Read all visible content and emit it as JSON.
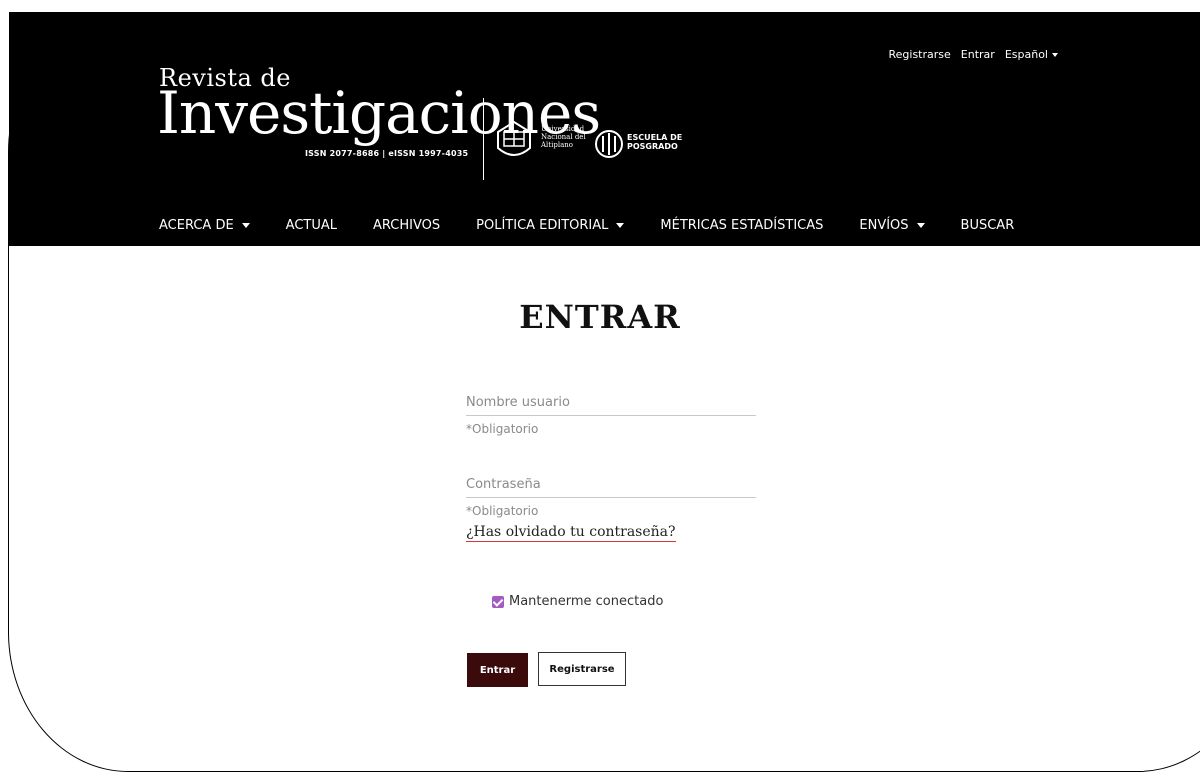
{
  "header": {
    "logo": {
      "line1": "Revista de",
      "line2": "Investigaciones",
      "issn": "ISSN 2077-8686 | eISSN 1997-4035",
      "university": "Universidad\nNacional del\nAltiplano",
      "school": "ESCUELA DE\nPOSGRADO"
    },
    "topnav": {
      "register": "Registrarse",
      "login": "Entrar",
      "language": "Español"
    },
    "mainnav": [
      {
        "label": "ACERCA DE",
        "dropdown": true
      },
      {
        "label": "ACTUAL",
        "dropdown": false
      },
      {
        "label": "ARCHIVOS",
        "dropdown": false
      },
      {
        "label": "POLÍTICA EDITORIAL",
        "dropdown": true
      },
      {
        "label": "MÉTRICAS ESTADÍSTICAS",
        "dropdown": false
      },
      {
        "label": "ENVÍOS",
        "dropdown": true
      },
      {
        "label": "BUSCAR",
        "dropdown": false
      }
    ]
  },
  "login": {
    "title": "ENTRAR",
    "username": {
      "placeholder": "Nombre usuario",
      "required": "*Obligatorio"
    },
    "password": {
      "placeholder": "Contraseña",
      "required": "*Obligatorio"
    },
    "forgot": "¿Has olvidado tu contraseña?",
    "remember": "Mantenerme conectado",
    "remember_checked": true,
    "submit": "Entrar",
    "register": "Registrarse"
  },
  "colors": {
    "header_bg": "#000000",
    "primary_button": "#3b0a0a",
    "checkbox": "#a45ac2",
    "link_underline": "#dd3333"
  }
}
